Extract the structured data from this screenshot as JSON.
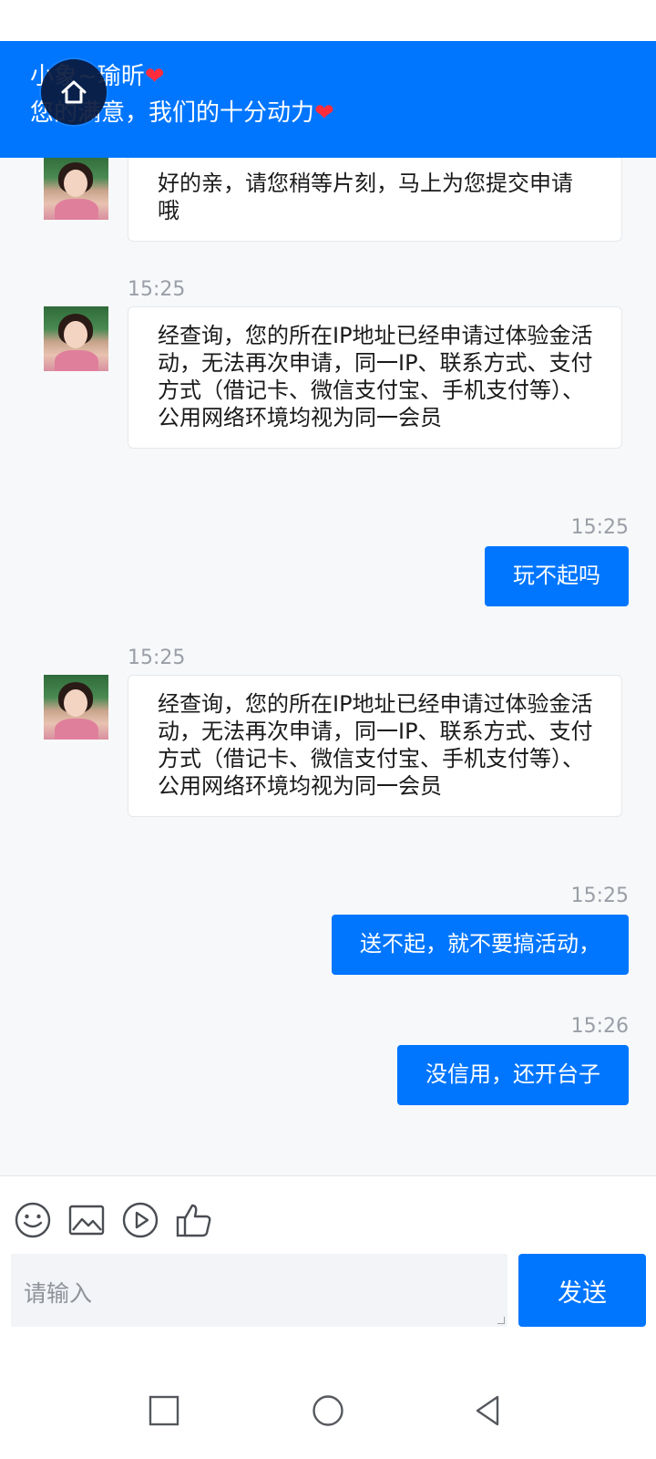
{
  "header": {
    "agent_name": "小象~瑜昕",
    "slogan": "您的满意，我们的十分动力",
    "heart_glyph": "❤",
    "bg_color": "#0076ff"
  },
  "home_button": {
    "icon": "home-icon"
  },
  "messages": [
    {
      "side": "in",
      "time": "",
      "text": "好的亲，请您稍等片刻，马上为您提交申请哦"
    },
    {
      "side": "in",
      "time": "15:25",
      "text": "经查询，您的所在IP地址已经申请过体验金活动，无法再次申请，同一IP、联系方式、支付方式（借记卡、微信支付宝、手机支付等）、公用网络环境均视为同一会员"
    },
    {
      "side": "out",
      "time": "15:25",
      "text": "玩不起吗"
    },
    {
      "side": "in",
      "time": "15:25",
      "text": "经查询，您的所在IP地址已经申请过体验金活动，无法再次申请，同一IP、联系方式、支付方式（借记卡、微信支付宝、手机支付等）、公用网络环境均视为同一会员"
    },
    {
      "side": "out",
      "time": "15:25",
      "text": "送不起，就不要搞活动，"
    },
    {
      "side": "out",
      "time": "15:26",
      "text": "没信用，还开台子"
    }
  ],
  "toolbar": {
    "icons": [
      "emoji-icon",
      "image-icon",
      "video-icon",
      "thumbs-up-icon"
    ]
  },
  "input": {
    "placeholder": "请输入",
    "value": ""
  },
  "send_button": {
    "label": "发送"
  },
  "nav": {
    "icons": [
      "recents-square-icon",
      "home-circle-icon",
      "back-triangle-icon"
    ]
  },
  "colors": {
    "accent": "#0076ff",
    "chat_bg": "#f7f8fa",
    "timestamp": "#9a9ea6"
  }
}
